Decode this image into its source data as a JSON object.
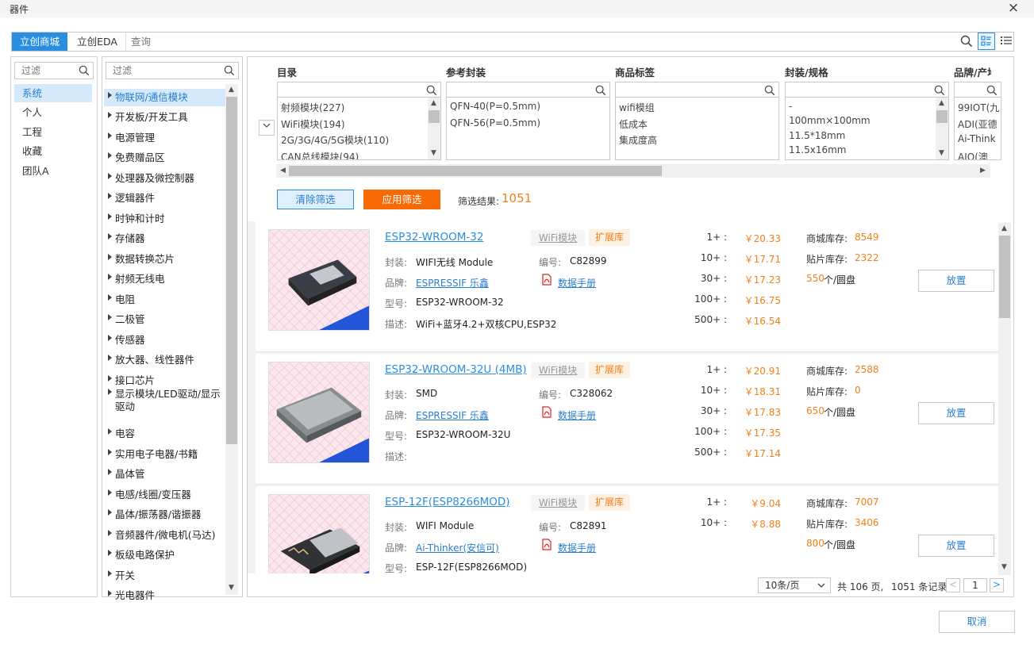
{
  "window": {
    "title": "器件",
    "close": "×"
  },
  "tabs": [
    {
      "label": "立创商城"
    },
    {
      "label": "立创EDA"
    }
  ],
  "search": {
    "placeholder": "查询"
  },
  "libraries": {
    "filter_placeholder": "过滤",
    "items": [
      {
        "label": "系统"
      },
      {
        "label": "个人"
      },
      {
        "label": "工程"
      },
      {
        "label": "收藏"
      },
      {
        "label": "团队A"
      }
    ]
  },
  "categories": {
    "filter_placeholder": "过滤",
    "items": [
      {
        "label": "物联网/通信模块"
      },
      {
        "label": "开发板/开发工具"
      },
      {
        "label": "电源管理"
      },
      {
        "label": "免费赠品区"
      },
      {
        "label": "处理器及微控制器"
      },
      {
        "label": "逻辑器件"
      },
      {
        "label": "时钟和计时"
      },
      {
        "label": "存储器"
      },
      {
        "label": "数据转换芯片"
      },
      {
        "label": "射频无线电"
      },
      {
        "label": "电阻"
      },
      {
        "label": "二极管"
      },
      {
        "label": "传感器"
      },
      {
        "label": "放大器、线性器件"
      },
      {
        "label": "接口芯片"
      },
      {
        "label": "显示模块/LED驱动/显示驱动"
      },
      {
        "label": "电容"
      },
      {
        "label": "实用电子电器/书籍"
      },
      {
        "label": "晶体管"
      },
      {
        "label": "电感/线圈/变压器"
      },
      {
        "label": "晶体/振荡器/谐振器"
      },
      {
        "label": "音频器件/微电机(马达)"
      },
      {
        "label": "板级电路保护"
      },
      {
        "label": "开关"
      },
      {
        "label": "光电器件"
      }
    ]
  },
  "filters": {
    "columns": [
      {
        "header": "目录",
        "options": [
          "射频模块(227)",
          "WiFi模块(194)",
          "2G/3G/4G/5G模块(110)",
          "CAN总线模块(94)"
        ]
      },
      {
        "header": "参考封装",
        "options": [
          "QFN-40(P=0.5mm)",
          "QFN-56(P=0.5mm)"
        ]
      },
      {
        "header": "商品标签",
        "options": [
          "wifi模组",
          "低成本",
          "集成度高"
        ]
      },
      {
        "header": "封装/规格",
        "options": [
          "-",
          "100mm×100mm",
          "11.5*18mm",
          "11.5x16mm"
        ]
      },
      {
        "header": "品牌/产地",
        "options": [
          "99IOT(九",
          "ADI(亚德",
          "Ai-Think",
          "AIO(澳"
        ]
      }
    ],
    "clear_label": "清除筛选",
    "apply_label": "应用筛选",
    "result_label": "筛选结果:",
    "result_count": "1051"
  },
  "labels": {
    "package": "封装:",
    "brand": "品牌:",
    "model": "型号:",
    "desc": "描述:",
    "code": "编号:",
    "datasheet": "数据手册",
    "mall_stock": "商城库存:",
    "smt_stock": "贴片库存:",
    "reel_suffix": "个/圆盘",
    "place": "放置"
  },
  "products": [
    {
      "name": "ESP32-WROOM-32",
      "tag": "WiFi模块",
      "ext": "扩展库",
      "package": "WIFI无线 Module",
      "code": "C82899",
      "brand": "ESPRESSIF 乐鑫",
      "model": "ESP32-WROOM-32",
      "desc": "WiFi+蓝牙4.2+双核CPU,ESP32",
      "prices": [
        {
          "qty": "1+ :",
          "price": "￥20.33"
        },
        {
          "qty": "10+ :",
          "price": "￥17.71"
        },
        {
          "qty": "30+ :",
          "price": "￥17.23"
        },
        {
          "qty": "100+ :",
          "price": "￥16.75"
        },
        {
          "qty": "500+ :",
          "price": "￥16.54"
        }
      ],
      "mall_stock": "8549",
      "smt_stock": "2322",
      "reel": "550"
    },
    {
      "name": "ESP32-WROOM-32U (4MB)",
      "tag": "WiFi模块",
      "ext": "扩展库",
      "package": "SMD",
      "code": "C328062",
      "brand": "ESPRESSIF 乐鑫",
      "model": "ESP32-WROOM-32U",
      "desc": "",
      "prices": [
        {
          "qty": "1+ :",
          "price": "￥20.91"
        },
        {
          "qty": "10+ :",
          "price": "￥18.31"
        },
        {
          "qty": "30+ :",
          "price": "￥17.83"
        },
        {
          "qty": "100+ :",
          "price": "￥17.35"
        },
        {
          "qty": "500+ :",
          "price": "￥17.14"
        }
      ],
      "mall_stock": "2588",
      "smt_stock": "0",
      "reel": "650"
    },
    {
      "name": "ESP-12F(ESP8266MOD)",
      "tag": "WiFi模块",
      "ext": "扩展库",
      "package": "WIFI Module",
      "code": "C82891",
      "brand": "Ai-Thinker(安信可)",
      "model": "ESP-12F(ESP8266MOD)",
      "desc": "",
      "prices": [
        {
          "qty": "1+ :",
          "price": "￥9.04"
        },
        {
          "qty": "10+ :",
          "price": "￥8.88"
        }
      ],
      "mall_stock": "7007",
      "smt_stock": "3406",
      "reel": "800"
    }
  ],
  "pagination": {
    "per_page": "10条/页",
    "total_pages": "共 106 页,",
    "total_records": "1051 条记录",
    "current": "1",
    "prev": "<",
    "next": ">"
  },
  "footer": {
    "cancel_label": "取消"
  },
  "colors": {
    "accent": "#2a8ee0",
    "orange": "#f0801a",
    "annotation": "#e02020"
  }
}
